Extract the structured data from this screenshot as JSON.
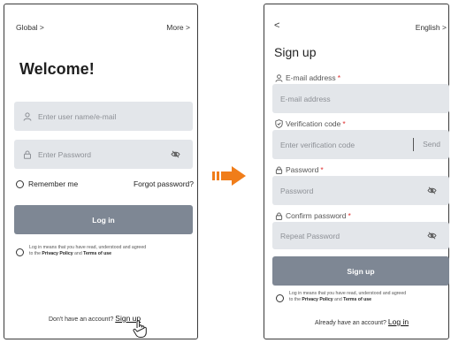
{
  "login": {
    "region_link": "Global >",
    "more_link": "More >",
    "welcome_title": "Welcome!",
    "username_placeholder": "Enter user name/e-mail",
    "password_placeholder": "Enter Password",
    "remember_label": "Remember me",
    "forgot_link": "Forgot password?",
    "login_button": "Log in",
    "consent": {
      "text_line1": "Log in means that you have read, understood and agreed",
      "text_prefix": "to the ",
      "privacy": "Privacy Policy",
      "and": " and ",
      "terms": "Terms of use"
    },
    "footer_text": "Don't have an account?",
    "signup_link": "Sign up"
  },
  "signup": {
    "back_label": "<",
    "language_link": "English >",
    "title": "Sign up",
    "email_label": "E-mail address",
    "email_placeholder": "E-mail address",
    "code_label": "Verification code",
    "code_placeholder": "Enter verification code",
    "send_button": "Send",
    "password_label": "Password",
    "password_placeholder": "Password",
    "confirm_label": "Confirm password",
    "confirm_placeholder": "Repeat Password",
    "required_marker": "*",
    "signup_button": "Sign up",
    "consent": {
      "text_line1": "Log in means that you have read, understood and agreed",
      "text_prefix": "to the ",
      "privacy": "Privacy Policy",
      "and": " and ",
      "terms": "Terms of use"
    },
    "footer_text": "Already have an account?",
    "login_link": "Log in"
  },
  "colors": {
    "field_bg": "#e3e6ea",
    "button_bg": "#7e8794",
    "required": "#e03030",
    "arrow": "#f07d1a"
  },
  "icons": [
    "user-icon",
    "lock-icon",
    "eye-off-icon",
    "shield-icon",
    "hand-pointer-icon",
    "arrow-right-icon"
  ]
}
